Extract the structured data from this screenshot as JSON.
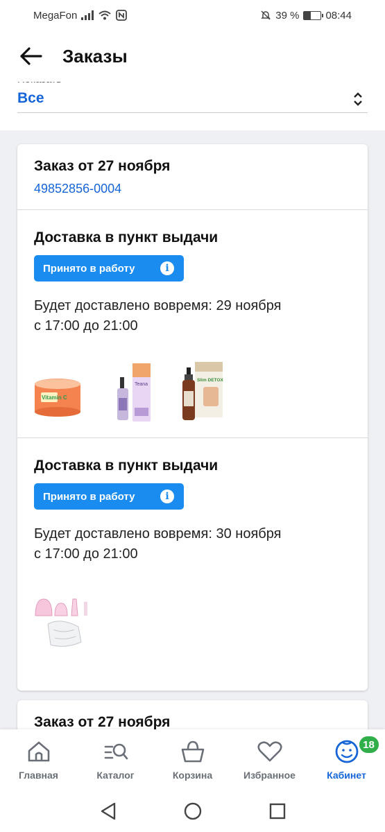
{
  "status_bar": {
    "carrier": "MegaFon",
    "battery": "39 %",
    "time": "08:44",
    "battery_level": 0.39
  },
  "header": {
    "title": "Заказы"
  },
  "filter": {
    "label": "Показать",
    "value": "Все"
  },
  "orders": [
    {
      "title": "Заказ от 27 ноября",
      "number": "49852856-0004",
      "shipments": [
        {
          "title": "Доставка в пункт выдачи",
          "status": "Принято в работу",
          "eta_line1": "Будет доставлено вовремя: 29 ноября",
          "eta_line2": "с 17:00 до 21:00",
          "products": [
            {
              "brand": "Vitamin C",
              "icon": "jar-icon"
            },
            {
              "brand": "Teana",
              "icon": "serum-bottle-icon"
            },
            {
              "brand": "Slim DETOX",
              "icon": "spray-bottle-icon"
            }
          ]
        },
        {
          "title": "Доставка в пункт выдачи",
          "status": "Принято в работу",
          "eta_line1": "Будет доставлено вовремя: 30 ноября",
          "eta_line2": "с 17:00 до 21:00",
          "products": [
            {
              "icon": "massage-cups-icon"
            }
          ]
        }
      ]
    },
    {
      "title": "Заказ от 27 ноября"
    }
  ],
  "bottom_nav": {
    "items": [
      {
        "label": "Главная",
        "icon": "home-icon"
      },
      {
        "label": "Каталог",
        "icon": "catalog-search-icon"
      },
      {
        "label": "Корзина",
        "icon": "basket-icon"
      },
      {
        "label": "Избранное",
        "icon": "heart-icon"
      },
      {
        "label": "Кабинет",
        "icon": "profile-icon",
        "badge": "18",
        "active": true
      }
    ]
  },
  "colors": {
    "accent": "#1565d8",
    "badge": "#1a8cf0",
    "nav_badge": "#2fae4a"
  }
}
